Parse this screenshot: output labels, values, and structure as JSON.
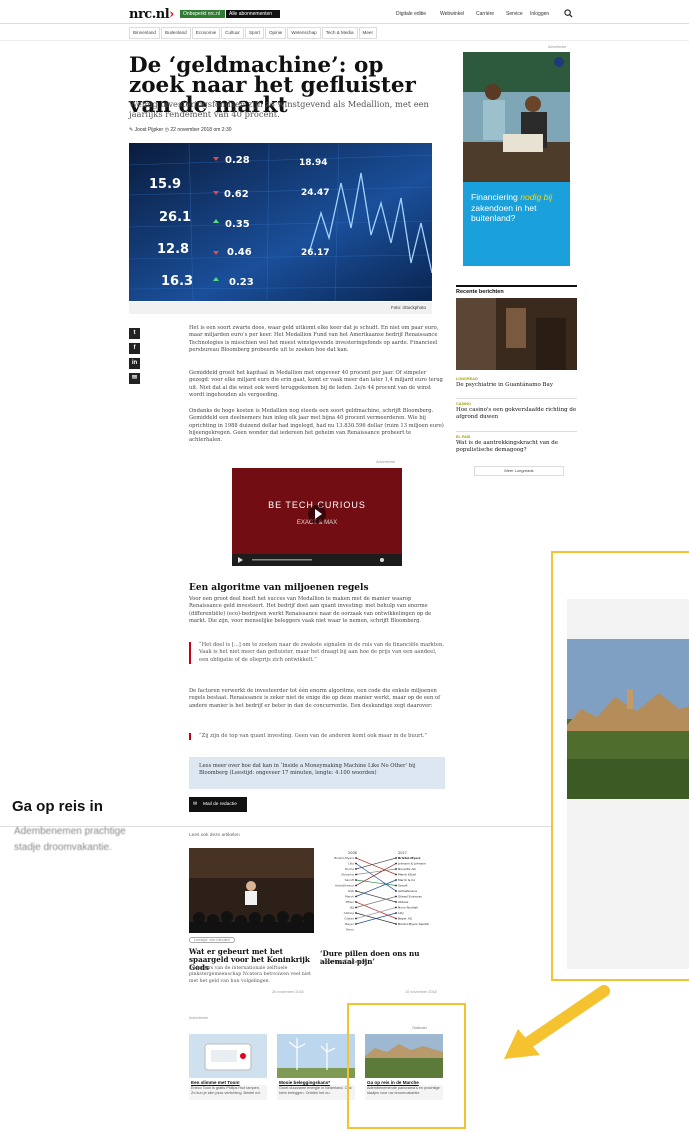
{
  "header": {
    "logo": "nrc.nl",
    "pill_subscribe": "Onbeperkt nrc.nl",
    "pill_all": "Alle abonnementen",
    "links": [
      "Digitale editie",
      "Webwinkel",
      "Carrière",
      "Service",
      "Inloggen"
    ]
  },
  "sections": [
    "Binnenland",
    "Buitenland",
    "Economie",
    "Cultuur",
    "Sport",
    "Opinie",
    "Wetenschap",
    "Tech & Media",
    "Meer"
  ],
  "article": {
    "headline": "De ‘geldmachine’: op zoek naar het gefluister van de markt",
    "standfirst": "Weinig investeringsfondsen zijn zo winstgevend als Medallion, met een jaarlijks rendement van 40 procent.",
    "author": "Joost Pijpker",
    "date": "22 november 2018 om 2:30",
    "photo_credit": "Foto: iStockphoto",
    "hero_numbers": [
      "0.28",
      "15.9",
      "26.1",
      "12.8",
      "16.3",
      "0.62",
      "0.35",
      "0.46",
      "0.23",
      "18.94",
      "24.47",
      "26.17"
    ],
    "p1": "Het is een soort zwarte doos, waar geld uitkomt elke keer dat je schudt. En niet om paar euro, maar miljarden euro’s per keer. Het Medallion Fund van het Amerikaanse bedrijf Renaissance Technologies is misschien wel het meest winstgevende investeringsfonds op aarde. Financieel persbureau Bloomberg probeerde uit te zoeken hoe dat kan.",
    "p2": "Gemiddeld groeit het kapitaal in Medallion met ongeveer 40 procent per jaar. Of simpeler gezegd: voor elke miljard euro die erin gaat, komt er vaak meer dan later 1,4 miljard euro terug uit. Niet dat al die winst ook werd teruggekomen bij de leden. 2e/n 44 procent van de winst wordt ingehouden als vergoeding.",
    "p3": "Ondanks de hoge kosten is Medallion nog steeds een soort geldmachine, schrijft Bloomberg. Gemiddeld een deelnemers hun inleg elk jaar met bijna 40 procent vermeerderen. Wie bij oprichting in 1988 duizend dollar had ingelegd, had nu 13.830.596 dollar (ruim 13 miljoen euro) bijeengekregen. Geen wonder dat iedereen het geheim van Renaissance probeert te achterhalen.",
    "ad_label": "Advertentie",
    "video_title": "BE TECH CURIOUS",
    "video_sub": "EXACT & MAX",
    "subheading": "Een algoritme van miljoenen regels",
    "p4": "Voor een groot deel hoeft het succes van Medallion te maken met de manier waarop Renaissance geld investeert. Het bedrijf doet aan quant investing: met behulp van enorme (differentiële) (eco)-bedrijven werkt Renaissance naar de oorzaak van ontwikkelingen op de markt. Die zijn, voor menselijke beleggers vaak niet waar te nemen, schrijft Bloomberg.",
    "quote1": "“Het doel is [...] om te zoeken naar de zwakste signalen in de ruis van de financiële markten. Vaak is het niet meer dan gefluister, maar het draagt bij aan hoe de prijs van een aandeel, een obligatie of de olieprijs zich ontwikkelt.”",
    "p5": "De factoren verwerkt de investeerder tot één enorm algoritme, een code die enkele miljoenen regels bestaat. Renaissance is zeker niet de enige die op deze manier werkt, maar op de een of andere manier is het bedrijf er beter in dan de concurrentie. Een deskundige zegt daarover:",
    "quote2": "“Zij zijn de top van quant investing. Geen van de anderen komt ook maar in de buurt.”",
    "readmore": "Lees meer over hoe dat kan in ‘Inside a Moneymaking Machine Like No Other’ bij Bloomberg (Leestijd: ongeveer 17 minuten, lengte: 4.100 woorden)",
    "mail_button": "Mail de redactie"
  },
  "related": {
    "heading": "Lees ook deze artikelen",
    "a1_tag": "Leestijd: vier minuten",
    "a1_title": "Wat er gebeurt met het spaargeld voor het Koninkrijk Gods",
    "a1_desc": "De leiders van de internationale zelftuele pinkstergemeenschap Ncatera betrouwen veel niet met het geld van hun volgelingen.",
    "a1_date": "26 november 2018",
    "a2_title": "‘Dure pillen doen ons nu allemaal pijn’",
    "a2_desc": "Interview Zeynep K.",
    "a2_date": "10 november 2018"
  },
  "chart_data": {
    "type": "line",
    "x": [
      "2008",
      "2017"
    ],
    "title": "",
    "labels_left": [
      "Bristol-Myers",
      "Lilly",
      "Roche",
      "Novartis",
      "Sanofi",
      "AstraZeneca",
      "GSK",
      "Merck",
      "Pfizer",
      "J&J",
      "Abbvie",
      "Gilead",
      "Bayer",
      "Novo"
    ],
    "labels_right": [
      "Bristol-Myers",
      "Johnson & Johnson",
      "Novartis AG",
      "Merck KGaA",
      "Merck & Co",
      "Sanofi",
      "AstraZeneca",
      "Gilead Sciences",
      "Abbvie",
      "Novo Nordisk",
      "Lilly",
      "Bayer AG",
      "Bristol-Myers Squibb"
    ],
    "series": [
      {
        "values": [
          1,
          4
        ]
      },
      {
        "values": [
          2,
          7
        ]
      },
      {
        "values": [
          3,
          1
        ]
      },
      {
        "values": [
          4,
          3
        ]
      },
      {
        "values": [
          5,
          6
        ]
      },
      {
        "values": [
          6,
          2
        ]
      },
      {
        "values": [
          7,
          9
        ]
      },
      {
        "values": [
          8,
          5
        ]
      },
      {
        "values": [
          9,
          12
        ]
      },
      {
        "values": [
          10,
          8
        ]
      },
      {
        "values": [
          11,
          13
        ]
      },
      {
        "values": [
          12,
          10
        ]
      },
      {
        "values": [
          13,
          11
        ]
      }
    ]
  },
  "offers": {
    "ad_label": "Advertentie",
    "badge": "Outbrain",
    "cards": [
      {
        "title": "Een slimme met Toon!",
        "desc": "Eneco Toon is gratis Philips Hue lampen. Zo kun je slim jouw verlichting. Bestel nu!"
      },
      {
        "title": "Mooie beleggingskans*",
        "desc": "Groei duurzame energie in Nederland. Ook klein beleggen. Ontdek het nu."
      },
      {
        "title": "Ga op reis in de Marche",
        "desc": "Adembenemende panorama's en prachtige stadjes voor uw droomvakantie."
      }
    ]
  },
  "sidebar": {
    "ad_label": "Advertentie",
    "ad_text_1": "Financiering",
    "ad_text_em": "nodig bij",
    "ad_text_2": "zakendoen in het buitenland?",
    "recent_heading": "Recente berichten",
    "recent": [
      {
        "tag": "LONGREAD",
        "title": "De psychiatrie in Guantánamo Bay"
      },
      {
        "tag": "CASINO",
        "title": "Hoe casino's een gokverslaafde richting de afgrond duwen"
      },
      {
        "tag": "EL PAÍS",
        "title": "Wat is de aantrekkingskracht van de populistische demagoog?"
      }
    ],
    "more_button": "Meer Longreads"
  },
  "zoom": {
    "title": "Ga op reis in",
    "desc": "Adembenemen prachtige stadje droomvakantie."
  },
  "colors": {
    "accent": "#e2001a",
    "highlight": "#f5c230",
    "ad_blue": "#1aa1db",
    "nav_green": "#2e7d32"
  }
}
